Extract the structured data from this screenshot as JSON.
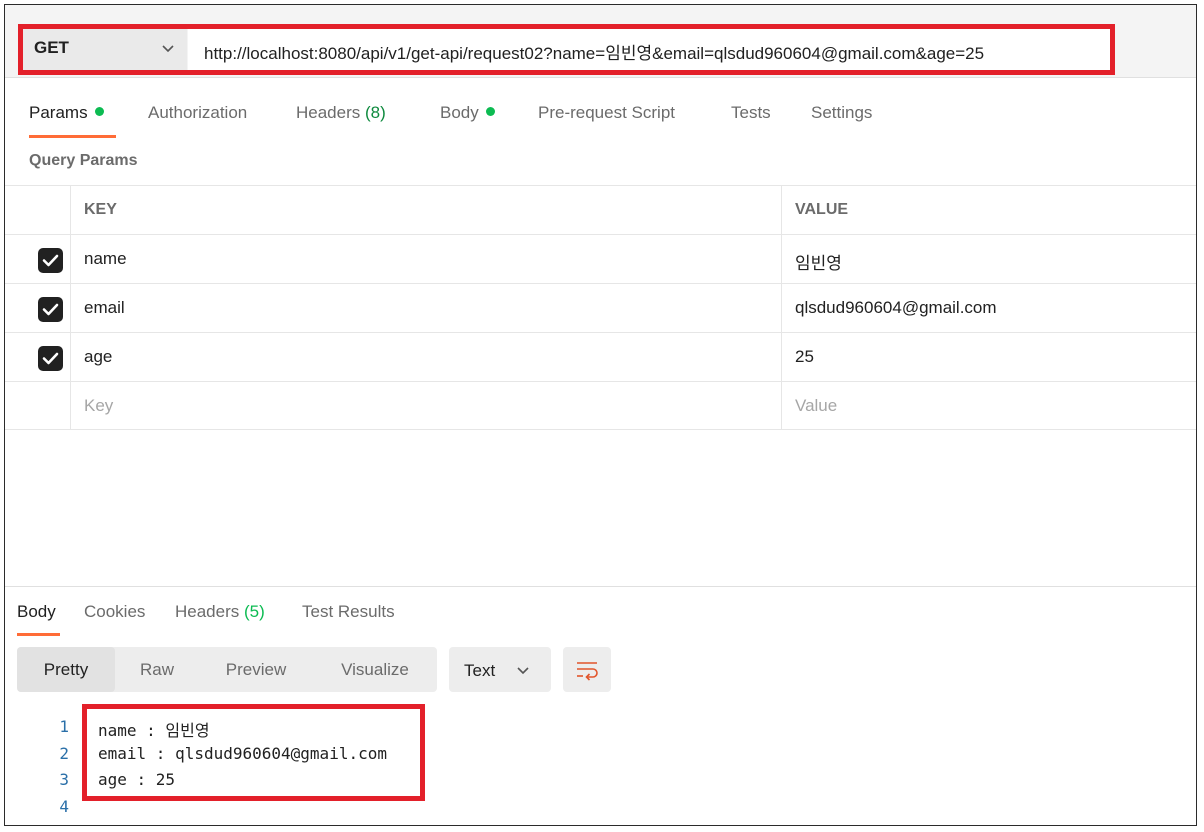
{
  "request": {
    "method": "GET",
    "url": "http://localhost:8080/api/v1/get-api/request02?name=임빈영&email=qlsdud960604@gmail.com&age=25"
  },
  "request_tabs": [
    {
      "label": "Params",
      "dot": true,
      "active": true
    },
    {
      "label": "Authorization"
    },
    {
      "label": "Headers",
      "count": "(8)"
    },
    {
      "label": "Body",
      "dot": true
    },
    {
      "label": "Pre-request Script"
    },
    {
      "label": "Tests"
    },
    {
      "label": "Settings"
    }
  ],
  "query_params": {
    "title": "Query Params",
    "headers": {
      "key": "KEY",
      "value": "VALUE"
    },
    "rows": [
      {
        "key": "name",
        "value": "임빈영",
        "checked": true
      },
      {
        "key": "email",
        "value": "qlsdud960604@gmail.com",
        "checked": true
      },
      {
        "key": "age",
        "value": "25",
        "checked": true
      }
    ],
    "placeholder": {
      "key": "Key",
      "value": "Value"
    }
  },
  "response_tabs": [
    {
      "label": "Body",
      "active": true
    },
    {
      "label": "Cookies"
    },
    {
      "label": "Headers",
      "count": "(5)"
    },
    {
      "label": "Test Results"
    }
  ],
  "view_modes": [
    "Pretty",
    "Raw",
    "Preview",
    "Visualize"
  ],
  "active_view_mode": "Pretty",
  "format": "Text",
  "response_body": {
    "line_numbers": [
      "1",
      "2",
      "3",
      "4"
    ],
    "lines": [
      "name : 임빈영",
      "email : qlsdud960604@gmail.com",
      "age : 25",
      ""
    ]
  },
  "colors": {
    "highlight_border": "#e3202a",
    "active_tab_underline": "#ff6c37",
    "status_dot": "#0cbb52",
    "count_green": "#0cbb52"
  },
  "icons": {
    "method_dropdown": "chevron-down-icon",
    "format_dropdown": "chevron-down-icon",
    "wrap_lines": "wrap-lines-icon",
    "checkbox": "checkmark-icon"
  }
}
